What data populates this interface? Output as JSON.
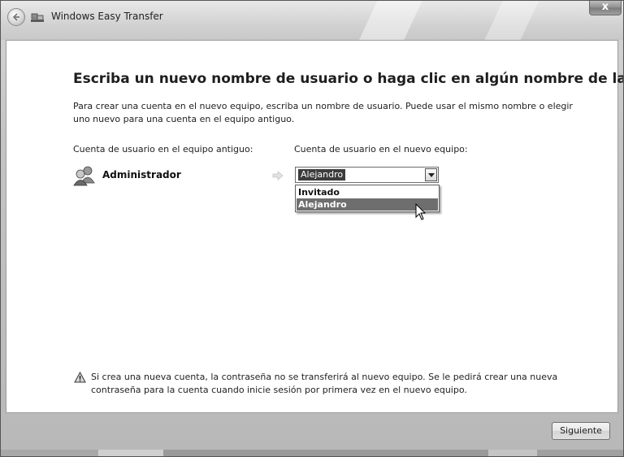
{
  "window": {
    "title": "Windows Easy Transfer",
    "close_label": "x"
  },
  "page": {
    "heading": "Escriba un nuevo nombre de usuario o haga clic en algún nombre de la lista",
    "intro": "Para crear una cuenta en el nuevo equipo, escriba un nombre de usuario. Puede usar el mismo nombre o elegir uno nuevo para una cuenta en el equipo antiguo.",
    "old_account_label": "Cuenta de usuario en el equipo antiguo:",
    "new_account_label": "Cuenta de usuario en el nuevo equipo:",
    "old_user_name": "Administrador",
    "combo_value": "Alejandro",
    "dropdown_options": [
      "Invitado",
      "Alejandro"
    ],
    "selected_option": "Alejandro",
    "warning": "Si crea una nueva cuenta, la contraseña no se transferirá al nuevo equipo. Se le pedirá crear una nueva contraseña para la cuenta cuando inicie sesión por primera vez en el nuevo equipo."
  },
  "footer": {
    "next_label": "Siguiente"
  },
  "icons": {
    "back": "back-arrow-icon",
    "app": "easy-transfer-icon",
    "user": "users-icon",
    "arrow": "right-arrow-icon",
    "warning": "warning-icon",
    "cursor": "mouse-pointer-icon"
  }
}
